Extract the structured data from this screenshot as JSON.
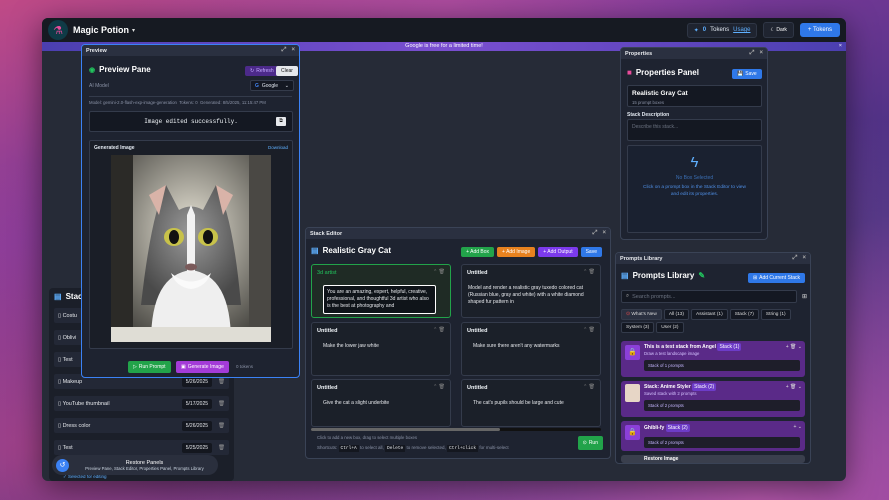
{
  "app": {
    "title": "Magic Potion",
    "token_count": "0",
    "tokens_label": "Tokens",
    "usage_label": "Usage",
    "dark_label": "Dark",
    "add_tokens_label": "+ Tokens"
  },
  "banner": {
    "text": "Google is free for a limited time!",
    "close": "×"
  },
  "preview": {
    "window_title": "Preview",
    "heading": "Preview Pane",
    "refresh_label": "Refresh",
    "clear_label": "Clear",
    "model_label": "AI Model",
    "model_value": "Google",
    "meta_model": "Model: gemini-2.0-flash-exp-image-generation",
    "meta_tokens": "Tokens: 0",
    "meta_generated": "Generated: 8/5/2025, 11:15:47 PM",
    "output_text": "Image edited successfully.",
    "generated_label": "Generated Image",
    "download_label": "Download",
    "run_label": "Run Prompt",
    "generate_label": "Generate Image",
    "tokens_hint": "0 tokens"
  },
  "properties": {
    "window_title": "Properties",
    "heading": "Properties Panel",
    "save_label": "Save",
    "name": "Realistic Gray Cat",
    "sub": "15 prompt boxes",
    "desc_label": "Stack Description",
    "desc_placeholder": "Describe this stack...",
    "empty_title": "No Box Selected",
    "empty_text_1": "Click on a prompt box in the Stack Editor to view",
    "empty_text_2": "and edit its properties."
  },
  "stack_editor": {
    "window_title": "Stack Editor",
    "heading": "Realistic Gray Cat",
    "add_box": "+ Add Box",
    "add_image": "+ Add Image",
    "add_output": "+ Add Output",
    "save": "Save",
    "cards": [
      {
        "title": "3d artist",
        "body": "You are an amazing, expert, helpful, creative, professional, and thoughtful 3d artist who also is the best at photography and"
      },
      {
        "title": "Untitled",
        "body": "Model and render a realistic gray tuxedo colored cat (Russian blue, gray and white) with a white diamond shaped fur pattern in"
      },
      {
        "title": "Untitled",
        "body": "Make the lower jaw white"
      },
      {
        "title": "Untitled",
        "body": "Make sure there aren't any watermarks"
      },
      {
        "title": "Untitled",
        "body": "Give the cat a slight underbite"
      },
      {
        "title": "Untitled",
        "body": "The cat's pupils should be large and cute"
      }
    ],
    "hint": "Click to add a new box, drag to select multiple boxes",
    "shortcuts_label": "Shortcuts:",
    "k1": "Ctrl+A",
    "k1_text": "to select all,",
    "k2": "Delete",
    "k2_text": "to remove selected,",
    "k3": "Ctrl+click",
    "k3_text": "for multi-select",
    "run_label": "Run"
  },
  "library": {
    "window_title": "Prompts Library",
    "heading": "Prompts Library",
    "add_current": "Add Current Stack",
    "search_placeholder": "Search prompts...",
    "chips": [
      "What's New",
      "All (13)",
      "Assistant (1)",
      "Stack (7)",
      "String (1)",
      "System (3)",
      "User (2)"
    ],
    "items": [
      {
        "title": "This is a test stack from Angel",
        "badge": "Stack (1)",
        "sub": "Draw a test landscape image",
        "box": "Stack of 1 prompts"
      },
      {
        "title": "Stack: Anime Styler",
        "badge": "Stack (2)",
        "sub": "Saved stack with 2 prompts",
        "box": "Stack of 2 prompts"
      },
      {
        "title": "Ghibli-fy",
        "badge": "Stack (2)",
        "sub": "",
        "box": "Stack of 2 prompts"
      },
      {
        "title": "Restore Image",
        "badge": "",
        "sub": "",
        "box": ""
      }
    ]
  },
  "sidebar": {
    "heading": "Stack",
    "rows": [
      {
        "name": "Costu",
        "date": ""
      },
      {
        "name": "Oblivi",
        "date": ""
      },
      {
        "name": "Test",
        "date": ""
      },
      {
        "name": "Makeup",
        "date": "5/26/2025"
      },
      {
        "name": "YouTube thumbnail",
        "date": "5/17/2025"
      },
      {
        "name": "Dress color",
        "date": "5/26/2025"
      },
      {
        "name": "Test",
        "date": "5/25/2025"
      }
    ],
    "selected_text": "✓ Selected for editing"
  },
  "restore": {
    "title": "Restore Panels",
    "sub": "Preview Pane, Stack Editor, Properties Panel, Prompts Library"
  }
}
